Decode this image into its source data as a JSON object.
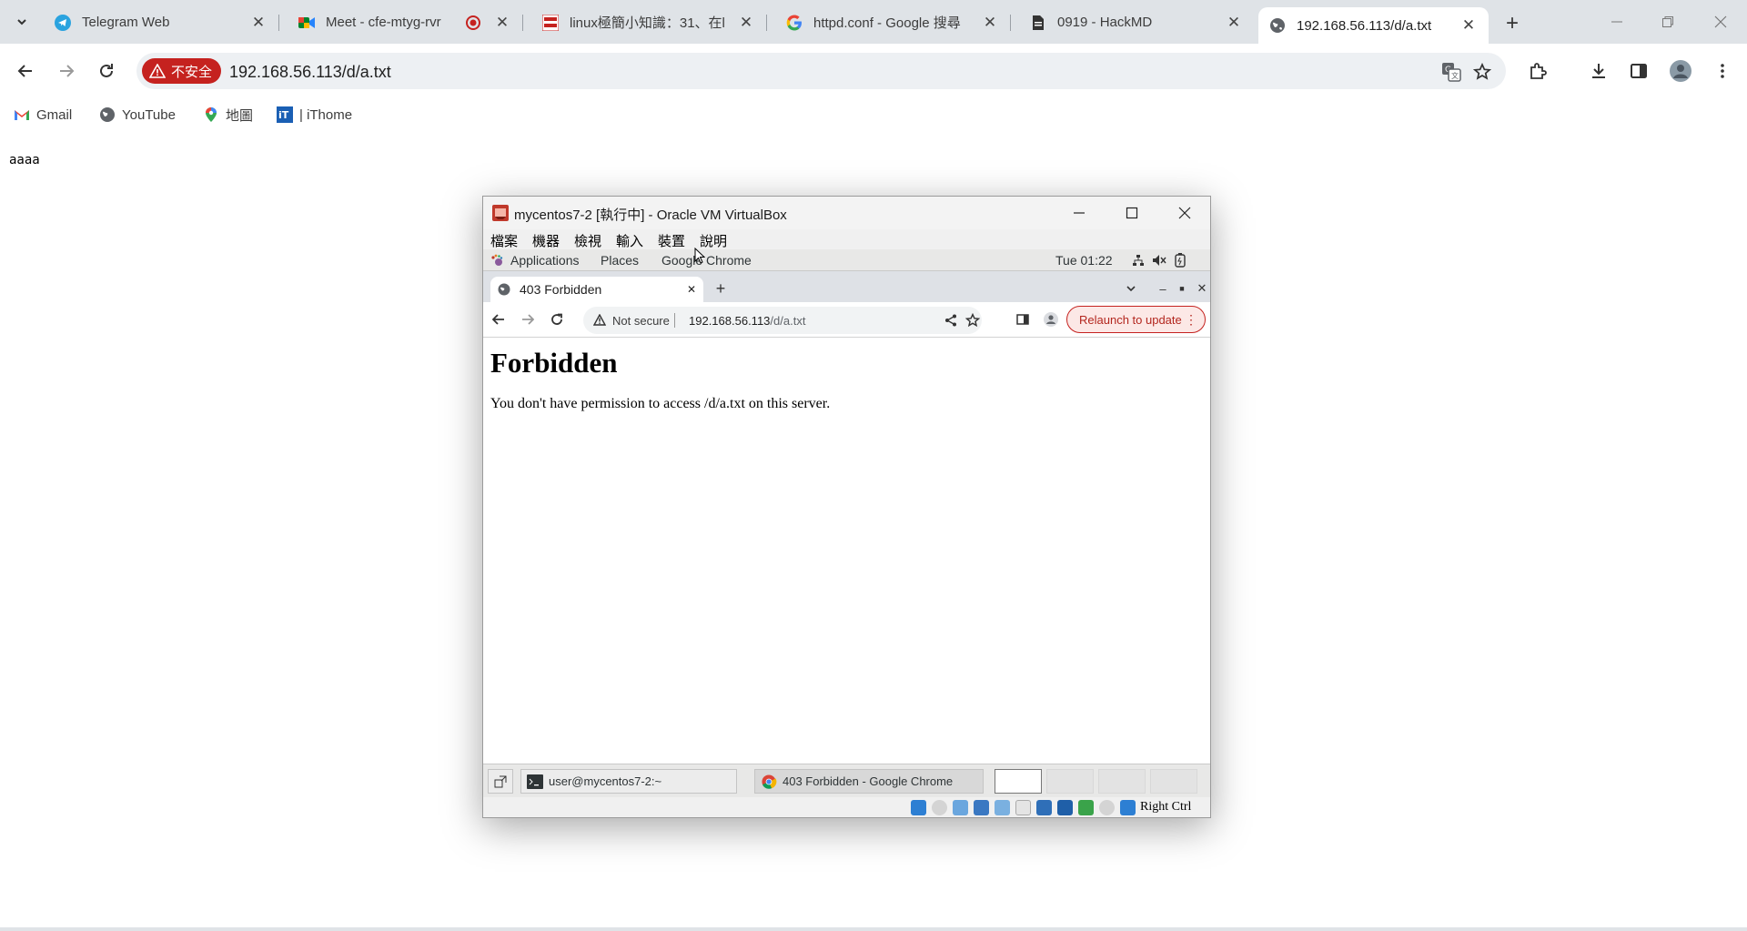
{
  "host": {
    "tabs": [
      {
        "title": "Telegram Web",
        "icon": "telegram-icon",
        "active": false
      },
      {
        "title": "Meet - cfe-mtyg-rvr",
        "icon": "google-meet-icon",
        "active": false
      },
      {
        "title": "linux極簡小知識：31、在l",
        "icon": "site-favicon-icon",
        "active": false
      },
      {
        "title": "httpd.conf - Google 搜尋",
        "icon": "google-icon",
        "active": false
      },
      {
        "title": "0919 - HackMD",
        "icon": "document-icon",
        "active": false
      },
      {
        "title": "192.168.56.113/d/a.txt",
        "icon": "globe-icon",
        "active": true
      }
    ],
    "insecure_label": "不安全",
    "url": "192.168.56.113/d/a.txt",
    "bookmarks": [
      {
        "label": "Gmail",
        "icon": "gmail-icon"
      },
      {
        "label": "YouTube",
        "icon": "globe-icon"
      },
      {
        "label": "地圖",
        "icon": "maps-pin-icon"
      },
      {
        "label": "| iThome",
        "icon": "ithome-icon"
      }
    ],
    "page_text": "aaaa"
  },
  "vbox": {
    "title": "mycentos7-2 [執行中] - Oracle VM VirtualBox",
    "menu": [
      "檔案",
      "機器",
      "檢視",
      "輸入",
      "裝置",
      "說明"
    ],
    "status_right": "Right Ctrl"
  },
  "guest": {
    "gnome_top": {
      "applications": "Applications",
      "places": "Places",
      "app_name": "Google Chrome",
      "clock": "Tue 01:22"
    },
    "tab_title": "403 Forbidden",
    "not_secure": "Not secure",
    "url_host": "192.168.56.113",
    "url_path": "/d/a.txt",
    "relaunch": "Relaunch to update",
    "heading": "Forbidden",
    "message": "You don't have permission to access /d/a.txt on this server.",
    "taskbar": [
      {
        "label": "user@mycentos7-2:~",
        "icon": "terminal-icon"
      },
      {
        "label": "403 Forbidden - Google Chrome",
        "icon": "chrome-icon"
      }
    ]
  },
  "colors": {
    "insecure_red": "#c5221f",
    "tabstrip": "#dfe3e7",
    "omnibox": "#edf0f3"
  }
}
